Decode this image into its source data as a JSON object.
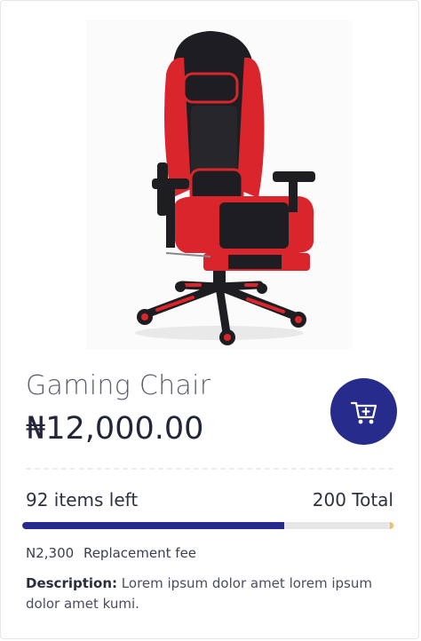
{
  "product": {
    "image_alt": "Gaming Chair image",
    "title": "Gaming Chair",
    "price": "₦12,000.00",
    "cart_icon": "add-to-cart-icon"
  },
  "stock": {
    "left_label": "92 items left",
    "total_label": "200 Total",
    "progress_fraction": 0.705
  },
  "fee": {
    "amount": "N2,300",
    "label": "Replacement fee"
  },
  "description": {
    "label": "Description:",
    "text": "Lorem ipsum dolor amet lorem ipsum dolor amet kumi."
  },
  "colors": {
    "accent": "#272b8c",
    "chair_red": "#d9252b",
    "chair_black": "#1e1e22"
  }
}
